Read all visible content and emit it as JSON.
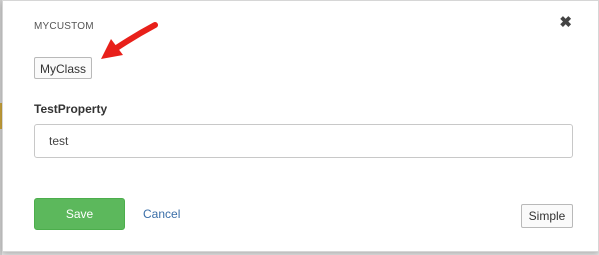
{
  "dialog": {
    "title": "MYCUSTOM",
    "close_icon": "close-icon",
    "class_badge": "MyClass"
  },
  "form": {
    "field_label": "TestProperty",
    "field_value": "test"
  },
  "footer": {
    "save_label": "Save",
    "cancel_label": "Cancel",
    "mode_label": "Simple"
  },
  "colors": {
    "save_button": "#5cb85c",
    "cancel_link": "#3a6ea8",
    "annotation_arrow": "#e8201a"
  }
}
